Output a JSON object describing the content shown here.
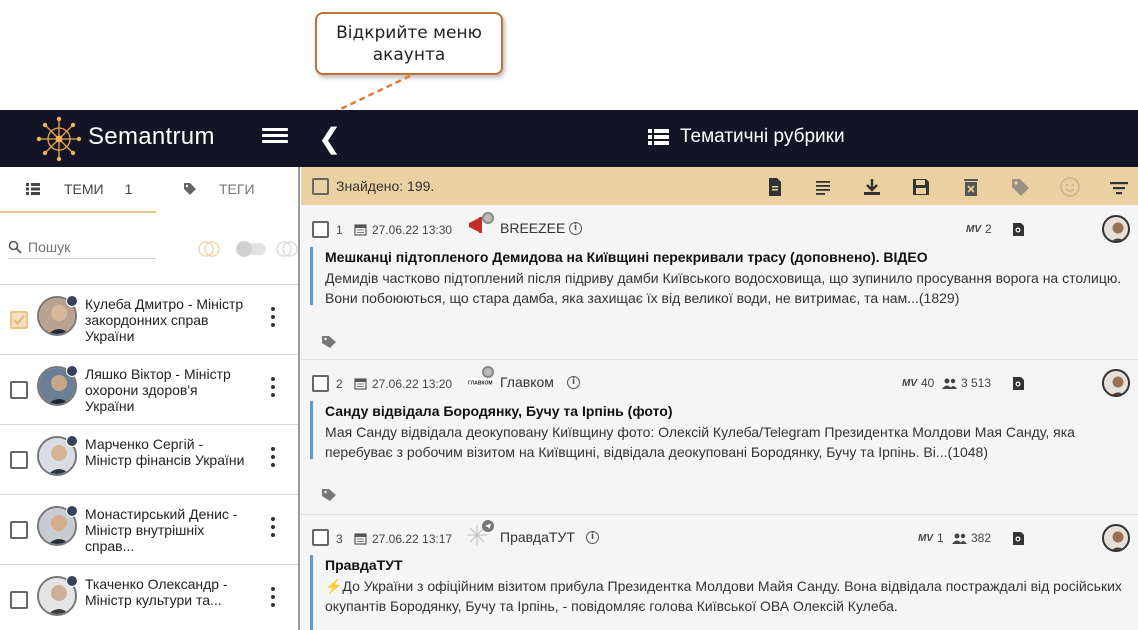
{
  "callout": {
    "text": "Відкрийте меню акаунта"
  },
  "topbar": {
    "brand": "Semantrum",
    "title": "Тематичні рубрики",
    "icons": [
      "menu-icon",
      "chevron-left-icon",
      "list-icon"
    ]
  },
  "sidebar": {
    "tabs": [
      {
        "label": "ТЕМИ",
        "count": "1",
        "icon": "list-icon"
      },
      {
        "label": "ТЕГИ",
        "icon": "tag-icon"
      }
    ],
    "search_placeholder": "Пошук",
    "people": [
      {
        "name": "Кулеба Дмитро - Міністр закордонних справ України",
        "checked": true
      },
      {
        "name": "Ляшко Віктор - Міністр охорони здоров'я України",
        "checked": false
      },
      {
        "name": "Марченко Сергій - Міністр фінансів України",
        "checked": false
      },
      {
        "name": "Монастирський Денис - Міністр внутрішніх справ...",
        "checked": false
      },
      {
        "name": "Ткаченко Олександр - Міністр культури та...",
        "checked": false
      }
    ]
  },
  "results": {
    "found_text": "Знайдено: 199.",
    "toolbar_icons": [
      "document-icon",
      "text-lines-icon",
      "download-icon",
      "save-icon",
      "delete-icon",
      "tag-icon",
      "smile-icon",
      "filter-icon"
    ],
    "items": [
      {
        "num": "1",
        "date": "27.06.22 13:30",
        "source": "BREEZEE",
        "mv": "2",
        "audience": "",
        "headline": "Мешканці підтопленого Демидова на Київщині перекривали трасу (доповнено). ВІДЕО",
        "body": "Демидів частково підтоплений після підриву дамби Київського водосховища, що зупинило просування ворога на столицю. Вони побоюються, що стара дамба, яка захищає їх від великої води, не витримає, та нам...(1829)"
      },
      {
        "num": "2",
        "date": "27.06.22 13:20",
        "source": "Главком",
        "mv": "40",
        "audience": "3 513",
        "headline": "Санду відвідала Бородянку, Бучу та Ірпінь (фото)",
        "body": "Мая Санду відвідала деокуповану Київщину фото: Олексій Кулеба/Telegram Президентка Молдови Мая Санду, яка перебуває з робочим візитом на Київщині, відвідала деокуповані Бородянку, Бучу та Ірпінь. Ві...(1048)"
      },
      {
        "num": "3",
        "date": "27.06.22 13:17",
        "source": "ПравдаТУТ",
        "mv": "1",
        "audience": "382",
        "headline": "ПравдаТУТ",
        "body": "⚡До України з офіційним візитом прибула Президентка Молдови Майя Санду. Вона відвідала постраждалі від російських окупантів Бородянку, Бучу та Ірпінь, - повідомляє голова Київської ОВА Олексій Кулеба."
      }
    ]
  },
  "colors": {
    "topbar": "#141427",
    "found_bar": "#ebd1a2",
    "accent": "#5b9bd5",
    "callout_border": "#c0713a"
  }
}
